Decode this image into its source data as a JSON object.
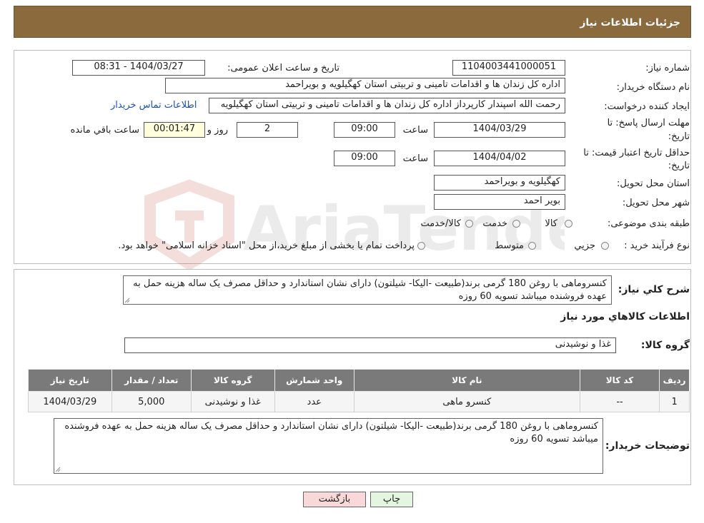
{
  "header": {
    "title": "جزئیات اطلاعات نیاز"
  },
  "form": {
    "need_number_label": "شماره نیاز:",
    "need_number": "1104003441000051",
    "announce_label": "تاریخ و ساعت اعلان عمومی:",
    "announce_value": "1404/03/27 - 08:31",
    "buyer_org_label": "نام دستگاه خریدار:",
    "buyer_org": "اداره کل زندان ها و اقدامات تامینی و تربیتی استان کهگیلویه و بویراحمد",
    "creator_label": "ایجاد کننده درخواست:",
    "creator": "رحمت الله اسپندار کارپرداز اداره کل زندان ها و اقدامات تامینی و تربیتی استان کهگیلویه",
    "contact_link": "اطلاعات تماس خریدار",
    "deadline_label_1": "مهلت ارسال پاسخ: تا",
    "deadline_label_2": "تاریخ:",
    "deadline_date": "1404/03/29",
    "time_label": "ساعت",
    "deadline_time": "09:00",
    "days_value": "2",
    "days_label": "روز و",
    "remaining_value": "00:01:47",
    "remaining_label": "ساعت باقي مانده",
    "validity_label_1": "حداقل تاریخ اعتبار قیمت: تا",
    "validity_label_2": "تاریخ:",
    "validity_date": "1404/04/02",
    "validity_time": "09:00",
    "province_label": "استان محل تحویل:",
    "province": "کهگیلویه و بویراحمد",
    "city_label": "شهر محل تحویل:",
    "city": "بویر احمد",
    "category_label": "طبقه بندی موضوعی:",
    "category_options": [
      "کالا",
      "خدمت",
      "کالا/خدمت"
    ],
    "process_label": "نوع فرآیند خرید :",
    "process_options": [
      "جزیي",
      "متوسط"
    ],
    "process_note": "پرداخت تمام یا بخشی از مبلغ خرید،از محل \"اسناد خزانه اسلامی\" خواهد بود."
  },
  "summary": {
    "label": "شرح کلي نياز:",
    "text": "کنسروماهی با روغن 180 گرمی برند(طبیعت -الیکا-  شیلتون) دارای نشان استاندارد و حداقل مصرف یک ساله هزینه حمل به عهده فروشنده میباشد تسویه 60 روزه"
  },
  "items_section": {
    "title": "اطلاعات کالاهاي مورد نياز",
    "group_label": "گروه کالا:",
    "group_value": "غذا و نوشیدنی"
  },
  "table": {
    "headers": [
      "رديف",
      "کد کالا",
      "نام کالا",
      "واحد شمارش",
      "گروه کالا",
      "تعداد / مقدار",
      "تاریخ نیاز"
    ],
    "rows": [
      [
        "1",
        "--",
        "کنسرو ماهی",
        "عدد",
        "غذا و نوشیدنی",
        "5,000",
        "1404/03/29"
      ]
    ]
  },
  "buyer_notes": {
    "label": "توضیحات خریدار:",
    "text": "کنسروماهی با روغن 180 گرمی برند(طبیعت -الیکا-  شیلتون) دارای نشان استاندارد و حداقل مصرف یک ساله هزینه حمل به عهده فروشنده میباشد تسویه 60 روزه"
  },
  "buttons": {
    "print": "چاپ",
    "back": "بازگشت"
  },
  "watermark": {
    "text": "AriaTender.neT"
  },
  "colors": {
    "header_bg": "#8b6a3e",
    "table_header_bg": "#7a7a7a",
    "link": "#1a4fb5",
    "back_button_bg": "#f8d8d8",
    "print_button_bg": "#e4f6e0"
  }
}
